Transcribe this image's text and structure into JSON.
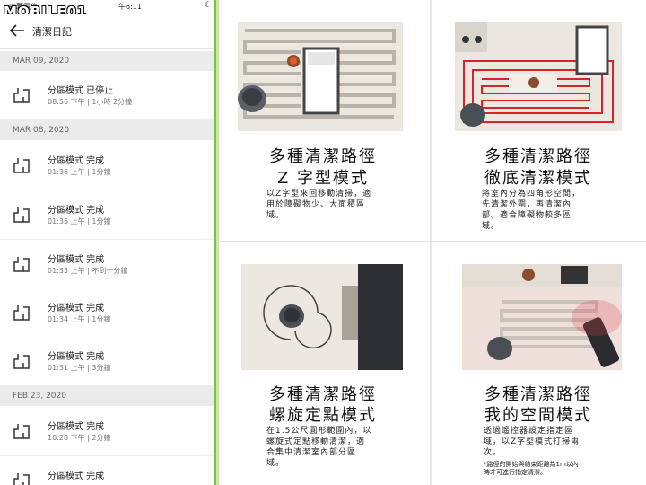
{
  "status_bar": {
    "carrier": "中華電信",
    "time": "午6:11"
  },
  "watermark": {
    "text": "MOBILE01"
  },
  "header": {
    "title": "清潔日記"
  },
  "history": {
    "sections": [
      {
        "date": "MAR 09, 2020"
      },
      {
        "date": "MAR 08, 2020"
      },
      {
        "date": "FEB 23, 2020"
      }
    ],
    "items": [
      {
        "mode": "分區模式 已停止",
        "detail": "08:56 下午 | 1小時 2分鐘"
      },
      {
        "mode": "分區模式 完成",
        "detail": "01:36 上午 | 1分鐘"
      },
      {
        "mode": "分區模式 完成",
        "detail": "01:35 上午 | 1分鐘"
      },
      {
        "mode": "分區模式 完成",
        "detail": "01:35 上午 | 不到一分鐘"
      },
      {
        "mode": "分區模式 完成",
        "detail": "01:34 上午 | 1分鐘"
      },
      {
        "mode": "分區模式 完成",
        "detail": "01:31 上午 | 3分鐘"
      },
      {
        "mode": "分區模式 完成",
        "detail": "10:28 下午 | 2分鐘"
      },
      {
        "mode": "分區模式 完成",
        "detail": ""
      }
    ]
  },
  "panels": [
    {
      "title1": "多種清潔路徑",
      "title2": "Z 字型模式",
      "desc": [
        "以Z字型來回移動清掃，適",
        "用於障礙物少、大面積區",
        "域。"
      ]
    },
    {
      "title1": "多種清潔路徑",
      "title2": "徹底清潔模式",
      "desc": [
        "將室內分為四角形空間，",
        "先清潔外圍，再清潔內",
        "部。適合障礙物較多區",
        "域。"
      ]
    },
    {
      "title1": "多種清潔路徑",
      "title2": "螺旋定點模式",
      "desc": [
        "在1.5公尺圓形範圍內，以",
        "螺旋式定點移動清潔，適",
        "合集中清潔室內部分區",
        "域。"
      ]
    },
    {
      "title1": "多種清潔路徑",
      "title2": "我的空間模式",
      "desc": [
        "透過遙控器設定指定區",
        "域，以Z字型模式打掃兩",
        "次。"
      ],
      "note": [
        "*路徑的開始與結束距離為1m以內",
        "時才可進行指定清潔。"
      ]
    }
  ],
  "colors": {
    "accent_green": "#7ec142",
    "path_red": "#d8232a"
  }
}
